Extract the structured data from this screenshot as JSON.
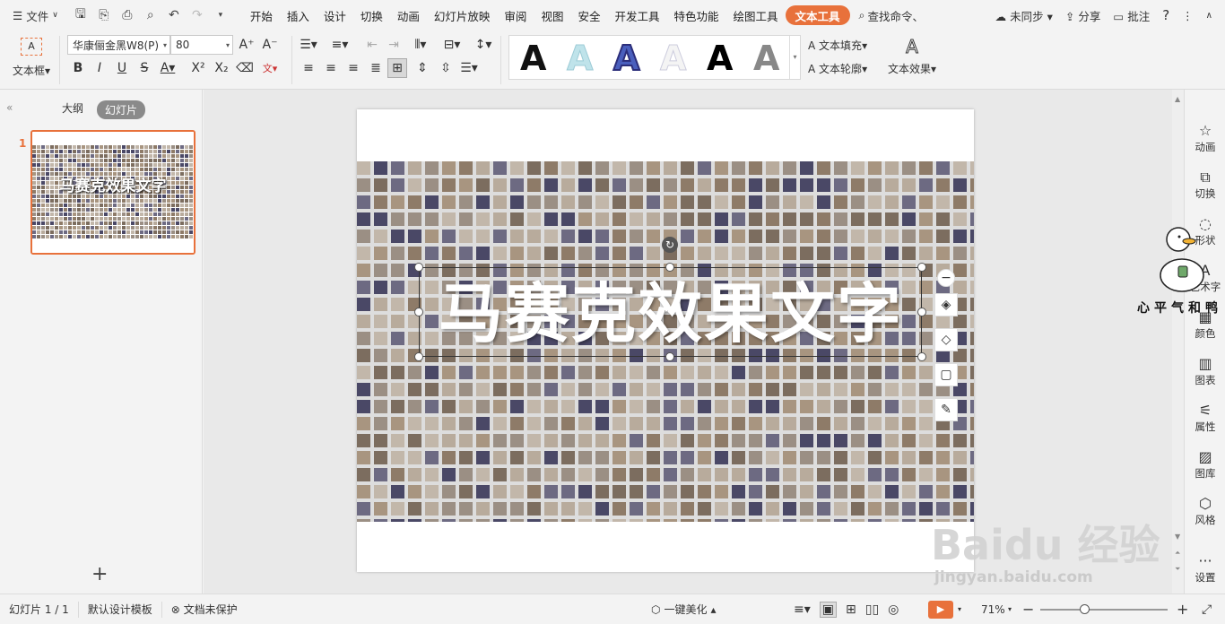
{
  "topbar": {
    "file_menu": "文件",
    "tabs": [
      "开始",
      "插入",
      "设计",
      "切换",
      "动画",
      "幻灯片放映",
      "审阅",
      "视图",
      "安全",
      "开发工具",
      "特色功能",
      "绘图工具",
      "文本工具"
    ],
    "active_tab": "文本工具",
    "search": "查找命令、",
    "sync": "未同步",
    "share": "分享",
    "comment": "批注"
  },
  "ribbon": {
    "textbox_label": "文本框",
    "font_name": "华康俪金黑W8(P)",
    "font_size": "80",
    "text_fill": "文本填充",
    "text_outline": "文本轮廓",
    "text_effect": "文本效果",
    "style_letter": "A"
  },
  "left_panel": {
    "tab_outline": "大纲",
    "tab_slides": "幻灯片",
    "slide_number": "1",
    "thumb_title": "马赛克效果文字",
    "add": "+"
  },
  "slide": {
    "title": "马赛克效果文字"
  },
  "right_bar": {
    "items": [
      "动画",
      "切换",
      "形状",
      "艺术字",
      "颜色",
      "图表",
      "属性",
      "图库",
      "风格",
      "设置"
    ]
  },
  "status": {
    "slide_count": "幻灯片 1 / 1",
    "template": "默认设计模板",
    "protect": "文档未保护",
    "beautify": "一键美化",
    "zoom": "71%"
  },
  "watermark": {
    "brand": "Baidu 经验",
    "url": "jingyan.baidu.com",
    "sticker": "心平气和鸭"
  },
  "colors": {
    "accent": "#e8713b",
    "tile_dark": "#4a4866",
    "tile_brown": "#8e7b68",
    "tile_light": "#b8ab9c"
  }
}
